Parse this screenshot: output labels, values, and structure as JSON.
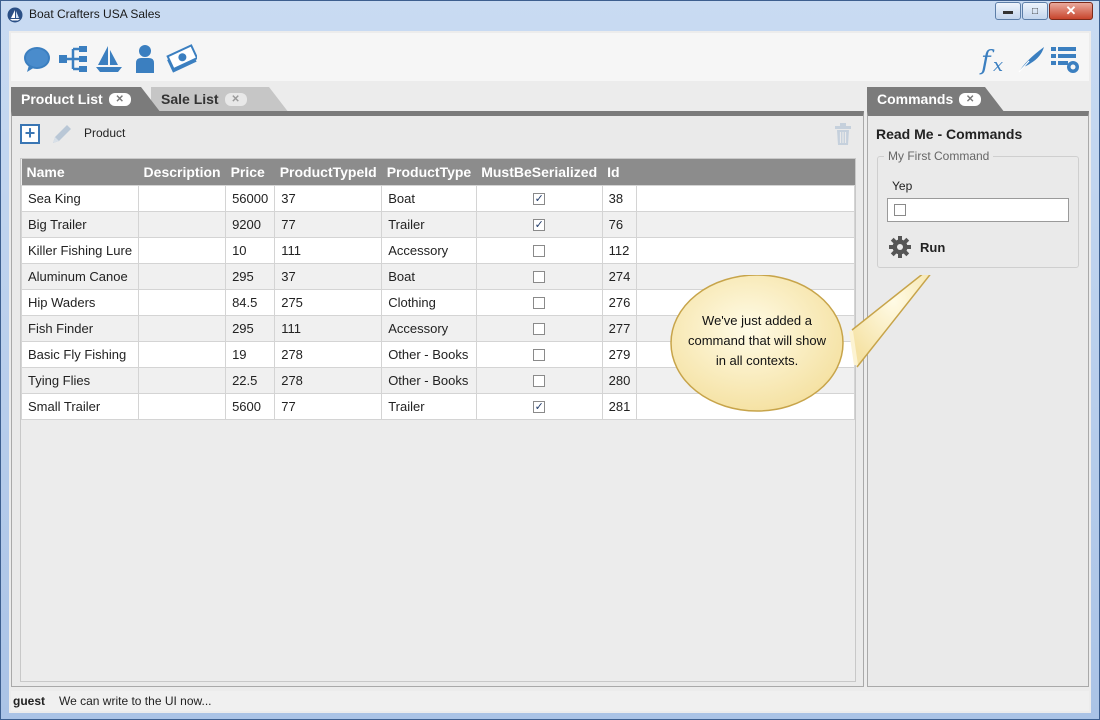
{
  "window": {
    "title": "Boat Crafters USA Sales",
    "minimize": "▬",
    "maximize": "□",
    "close": "✕"
  },
  "toolbar": {
    "left_icons": [
      "chat-bubble-icon",
      "hierarchy-icon",
      "sailboat-icon",
      "person-icon",
      "money-icon"
    ],
    "right_icons": [
      "function-fx-icon",
      "quill-pen-icon",
      "list-settings-icon"
    ],
    "fx_label": "fx"
  },
  "left_tabs": [
    {
      "label": "Product List",
      "close": "✕"
    },
    {
      "label": "Sale List",
      "close": "✕"
    }
  ],
  "product_list": {
    "entity_label": "Product",
    "add_label": "+",
    "columns": [
      "Name",
      "Description",
      "Price",
      "ProductTypeId",
      "ProductType",
      "MustBeSerialized",
      "Id"
    ],
    "rows": [
      {
        "name": "Sea King",
        "description": "",
        "price": "56000",
        "product_type_id": "37",
        "product_type": "Boat",
        "serialized": "✓",
        "id": "38"
      },
      {
        "name": "Big Trailer",
        "description": "",
        "price": "9200",
        "product_type_id": "77",
        "product_type": "Trailer",
        "serialized": "✓",
        "id": "76"
      },
      {
        "name": "Killer Fishing Lure",
        "description": "",
        "price": "10",
        "product_type_id": "111",
        "product_type": "Accessory",
        "serialized": "",
        "id": "112"
      },
      {
        "name": "Aluminum Canoe",
        "description": "",
        "price": "295",
        "product_type_id": "37",
        "product_type": "Boat",
        "serialized": "",
        "id": "274"
      },
      {
        "name": "Hip Waders",
        "description": "",
        "price": "84.5",
        "product_type_id": "275",
        "product_type": "Clothing",
        "serialized": "",
        "id": "276"
      },
      {
        "name": "Fish Finder",
        "description": "",
        "price": "295",
        "product_type_id": "111",
        "product_type": "Accessory",
        "serialized": "",
        "id": "277"
      },
      {
        "name": "Basic Fly Fishing",
        "description": "",
        "price": "19",
        "product_type_id": "278",
        "product_type": "Other - Books",
        "serialized": "",
        "id": "279"
      },
      {
        "name": "Tying Flies",
        "description": "",
        "price": "22.5",
        "product_type_id": "278",
        "product_type": "Other - Books",
        "serialized": "",
        "id": "280"
      },
      {
        "name": "Small Trailer",
        "description": "",
        "price": "5600",
        "product_type_id": "77",
        "product_type": "Trailer",
        "serialized": "✓",
        "id": "281"
      }
    ]
  },
  "commands_tab": {
    "label": "Commands",
    "close": "✕"
  },
  "commands": {
    "title": "Read Me - Commands",
    "group_label": "My First Command",
    "field_label": "Yep",
    "run_label": "Run"
  },
  "callout": {
    "lines": [
      "We've just added a",
      "command that will show",
      "in all contexts."
    ]
  },
  "status": {
    "user": "guest",
    "message": "We can write to the UI now..."
  }
}
